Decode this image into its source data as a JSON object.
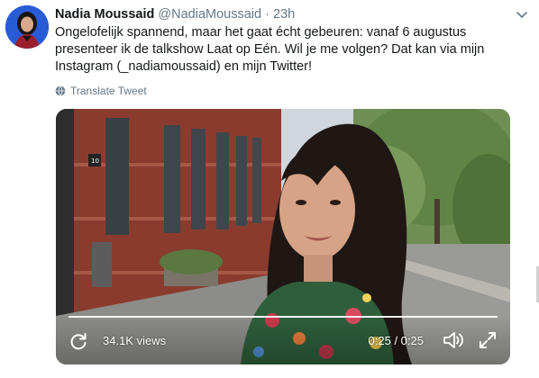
{
  "tweet": {
    "author_name": "Nadia Moussaid",
    "handle": "@NadiaMoussaid",
    "separator": "·",
    "time": "23h",
    "text": "Ongelofelijk spannend, maar het gaat écht gebeuren: vanaf 6 augustus presenteer ik de talkshow Laat op Eén. Wil je me volgen? Dat kan via mijn Instagram (_nadiamoussaid) en mijn Twitter!",
    "translate_label": "Translate Tweet"
  },
  "video": {
    "views": "34.1K views",
    "time_display": "0:25 / 0:25",
    "progress_fraction": 1.0,
    "door_number": "10"
  },
  "icons": {
    "caret": "chevron-down-icon",
    "globe": "globe-icon",
    "replay": "replay-icon",
    "volume": "volume-icon",
    "fullscreen": "fullscreen-icon"
  },
  "colors": {
    "text": "#14171a",
    "muted": "#657786",
    "avatar_bg": "#2a5bd7"
  }
}
